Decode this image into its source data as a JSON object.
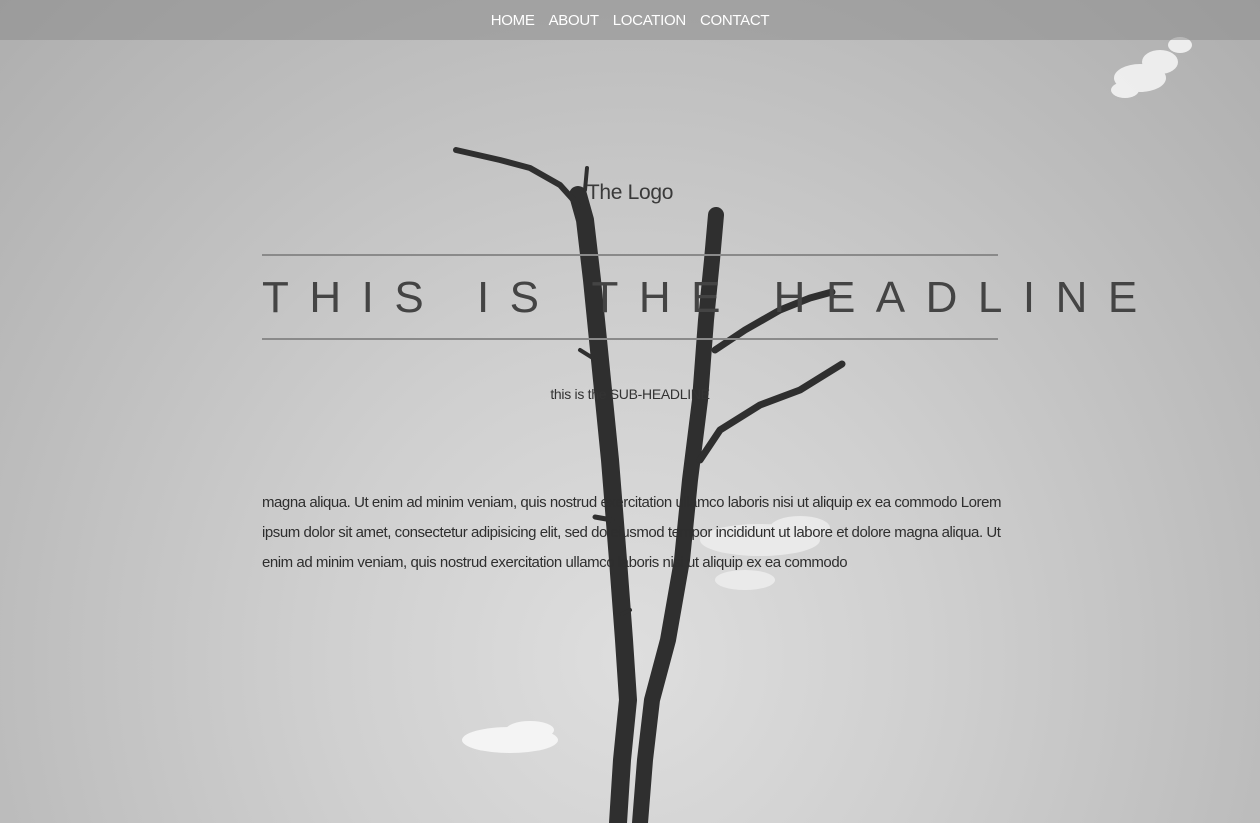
{
  "nav": {
    "items": [
      {
        "label": "HOME"
      },
      {
        "label": "ABOUT"
      },
      {
        "label": "LOCATION"
      },
      {
        "label": "CONTACT"
      }
    ]
  },
  "logo": {
    "text": "The Logo"
  },
  "headline": {
    "text": "THIS IS THE HEADLINE"
  },
  "subheadline": {
    "text": "this is the SUB-HEADLINE"
  },
  "body": {
    "paragraph": "magna aliqua. Ut enim ad minim veniam, quis nostrud exercitation ullamco laboris nisi ut aliquip ex ea commodo Lorem ipsum dolor sit amet, consectetur adipisicing elit, sed do eiusmod tempor incididunt ut labore et dolore magna aliqua. Ut enim ad minim veniam, quis nostrud exercitation ullamco laboris nisi ut aliquip ex ea commodo"
  },
  "colors": {
    "text": "#444444",
    "nav_text": "#ffffff",
    "rule": "#8a8a8a"
  }
}
